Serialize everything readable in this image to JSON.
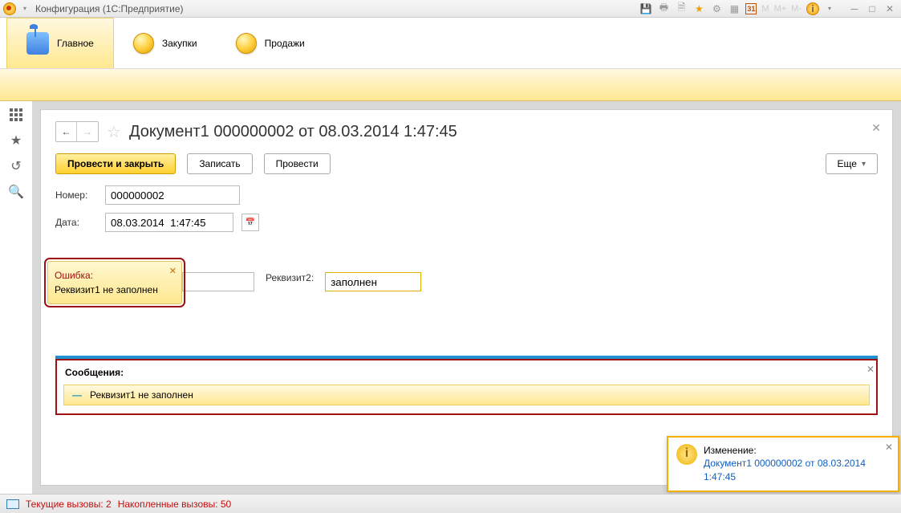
{
  "titlebar": {
    "title": "Конфигурация  (1С:Предприятие)",
    "m": "M",
    "mp": "M+",
    "mm": "M-",
    "cal": "31"
  },
  "nav": {
    "main": "Главное",
    "purchases": "Закупки",
    "sales": "Продажи"
  },
  "page": {
    "title": "Документ1 000000002 от 08.03.2014 1:47:45"
  },
  "buttons": {
    "post_close": "Провести и закрыть",
    "write": "Записать",
    "post": "Провести",
    "more": "Еще"
  },
  "form": {
    "number_label": "Номер:",
    "number": "000000002",
    "date_label": "Дата:",
    "date": "08.03.2014  1:47:45",
    "req2_label": "Реквизит2:",
    "req2_value": "заполнен"
  },
  "error_popup": {
    "title": "Ошибка:",
    "text": "Реквизит1 не заполнен"
  },
  "messages": {
    "title": "Сообщения:",
    "item": "Реквизит1 не заполнен"
  },
  "toast": {
    "title": "Изменение:",
    "link": "Документ1 000000002 от 08.03.2014 1:47:45"
  },
  "status": {
    "calls": "Текущие вызовы: 2",
    "accum": "Накопленные вызовы: 50"
  }
}
